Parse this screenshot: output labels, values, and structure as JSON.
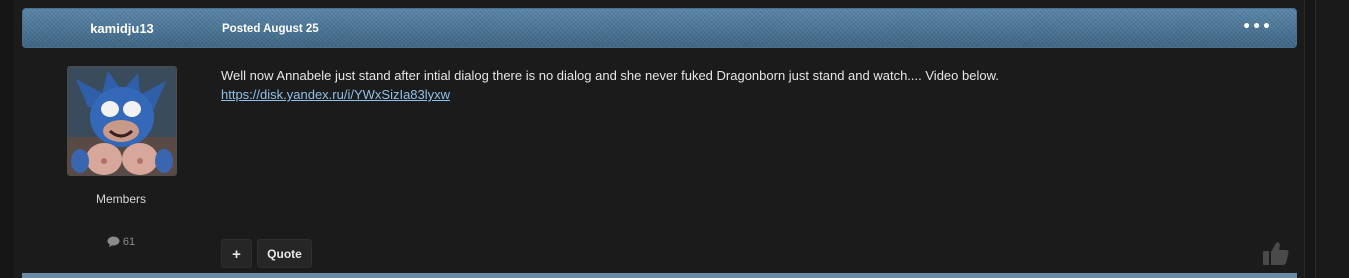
{
  "post": {
    "author": "kamidju13",
    "posted": "Posted August 25",
    "more_label": "•••",
    "member_group": "Members",
    "post_count": "61",
    "body_text": "Well now Annabele just stand after intial dialog there is no dialog and she never fuked Dragonborn just stand and watch.... Video below.",
    "link_text": "https://disk.yandex.ru/i/YWxSizIa83lyxw",
    "actions": {
      "plus_label": "+",
      "quote_label": "Quote"
    }
  },
  "icons": {
    "more": "ellipsis-icon",
    "post_count": "comment-bubble-icon",
    "like": "thumbs-up-icon"
  },
  "colors": {
    "page_bg": "#1b1b1b",
    "header_blue": "#4a7597",
    "link": "#8fc0ea",
    "text": "#e6e6e6"
  }
}
